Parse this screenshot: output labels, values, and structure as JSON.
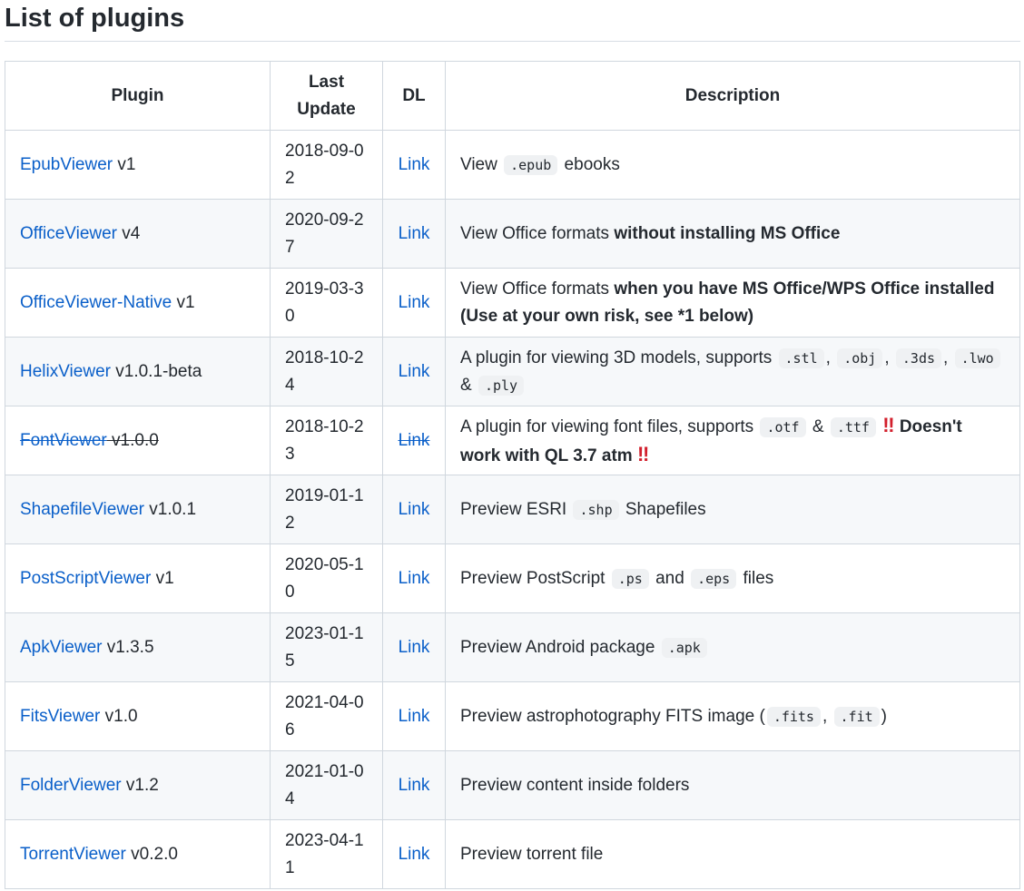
{
  "heading": "List of plugins",
  "headers": {
    "plugin": "Plugin",
    "last_update": "Last Update",
    "dl": "DL",
    "description": "Description"
  },
  "link_label": "Link",
  "rows": [
    {
      "name": "EpubViewer",
      "version": " v1",
      "date": "2018-09-02",
      "d": {
        "t1": "View ",
        "c1": ".epub",
        "t2": " ebooks"
      }
    },
    {
      "name": "OfficeViewer",
      "version": " v4",
      "date": "2020-09-27",
      "d": {
        "t1": "View Office formats ",
        "b1": "without installing MS Office"
      }
    },
    {
      "name": "OfficeViewer-Native",
      "version": " v1",
      "date": "2019-03-30",
      "d": {
        "t1": "View Office formats ",
        "b1": "when you have MS Office/WPS Office installed (Use at your own risk, see *1 below)"
      }
    },
    {
      "name": "HelixViewer",
      "version": " v1.0.1-beta",
      "date": "2018-10-24",
      "d": {
        "t1": "A plugin for viewing 3D models, supports ",
        "c1": ".stl",
        "t2": ", ",
        "c2": ".obj",
        "t3": ", ",
        "c3": ".3ds",
        "t4": ", ",
        "c4": ".lwo",
        "t5": " & ",
        "c5": ".ply"
      }
    },
    {
      "name": "FontViewer",
      "version": " v1.0.0",
      "date": "2018-10-23",
      "deprecated": true,
      "d": {
        "t1": "A plugin for viewing font files, supports ",
        "c1": ".otf",
        "t2": " & ",
        "c2": ".ttf",
        "bang1": "‼",
        "b1": "Doesn't work with QL 3.7 atm",
        "bang2": "‼"
      }
    },
    {
      "name": "ShapefileViewer",
      "version": " v1.0.1",
      "date": "2019-01-12",
      "d": {
        "t1": "Preview ESRI ",
        "c1": ".shp",
        "t2": " Shapefiles"
      }
    },
    {
      "name": "PostScriptViewer",
      "version": " v1",
      "date": "2020-05-10",
      "d": {
        "t1": "Preview PostScript ",
        "c1": ".ps",
        "t2": " and ",
        "c2": ".eps",
        "t3": " files"
      }
    },
    {
      "name": "ApkViewer",
      "version": " v1.3.5",
      "date": "2023-01-15",
      "d": {
        "t1": "Preview Android package ",
        "c1": ".apk"
      }
    },
    {
      "name": "FitsViewer",
      "version": " v1.0",
      "date": "2021-04-06",
      "d": {
        "t1": "Preview astrophotography FITS image (",
        "c1": ".fits",
        "t2": ", ",
        "c2": ".fit",
        "t3": ")"
      }
    },
    {
      "name": "FolderViewer",
      "version": " v1.2",
      "date": "2021-01-04",
      "d": {
        "t1": "Preview content inside folders"
      }
    },
    {
      "name": "TorrentViewer",
      "version": " v0.2.0",
      "date": "2023-04-11",
      "d": {
        "t1": "Preview torrent file"
      }
    }
  ],
  "colors": {
    "link": "#0a5fc9",
    "border": "#d0d7de",
    "stripe": "#f6f8fa",
    "text": "#24292f",
    "alert": "#d21f2c"
  }
}
